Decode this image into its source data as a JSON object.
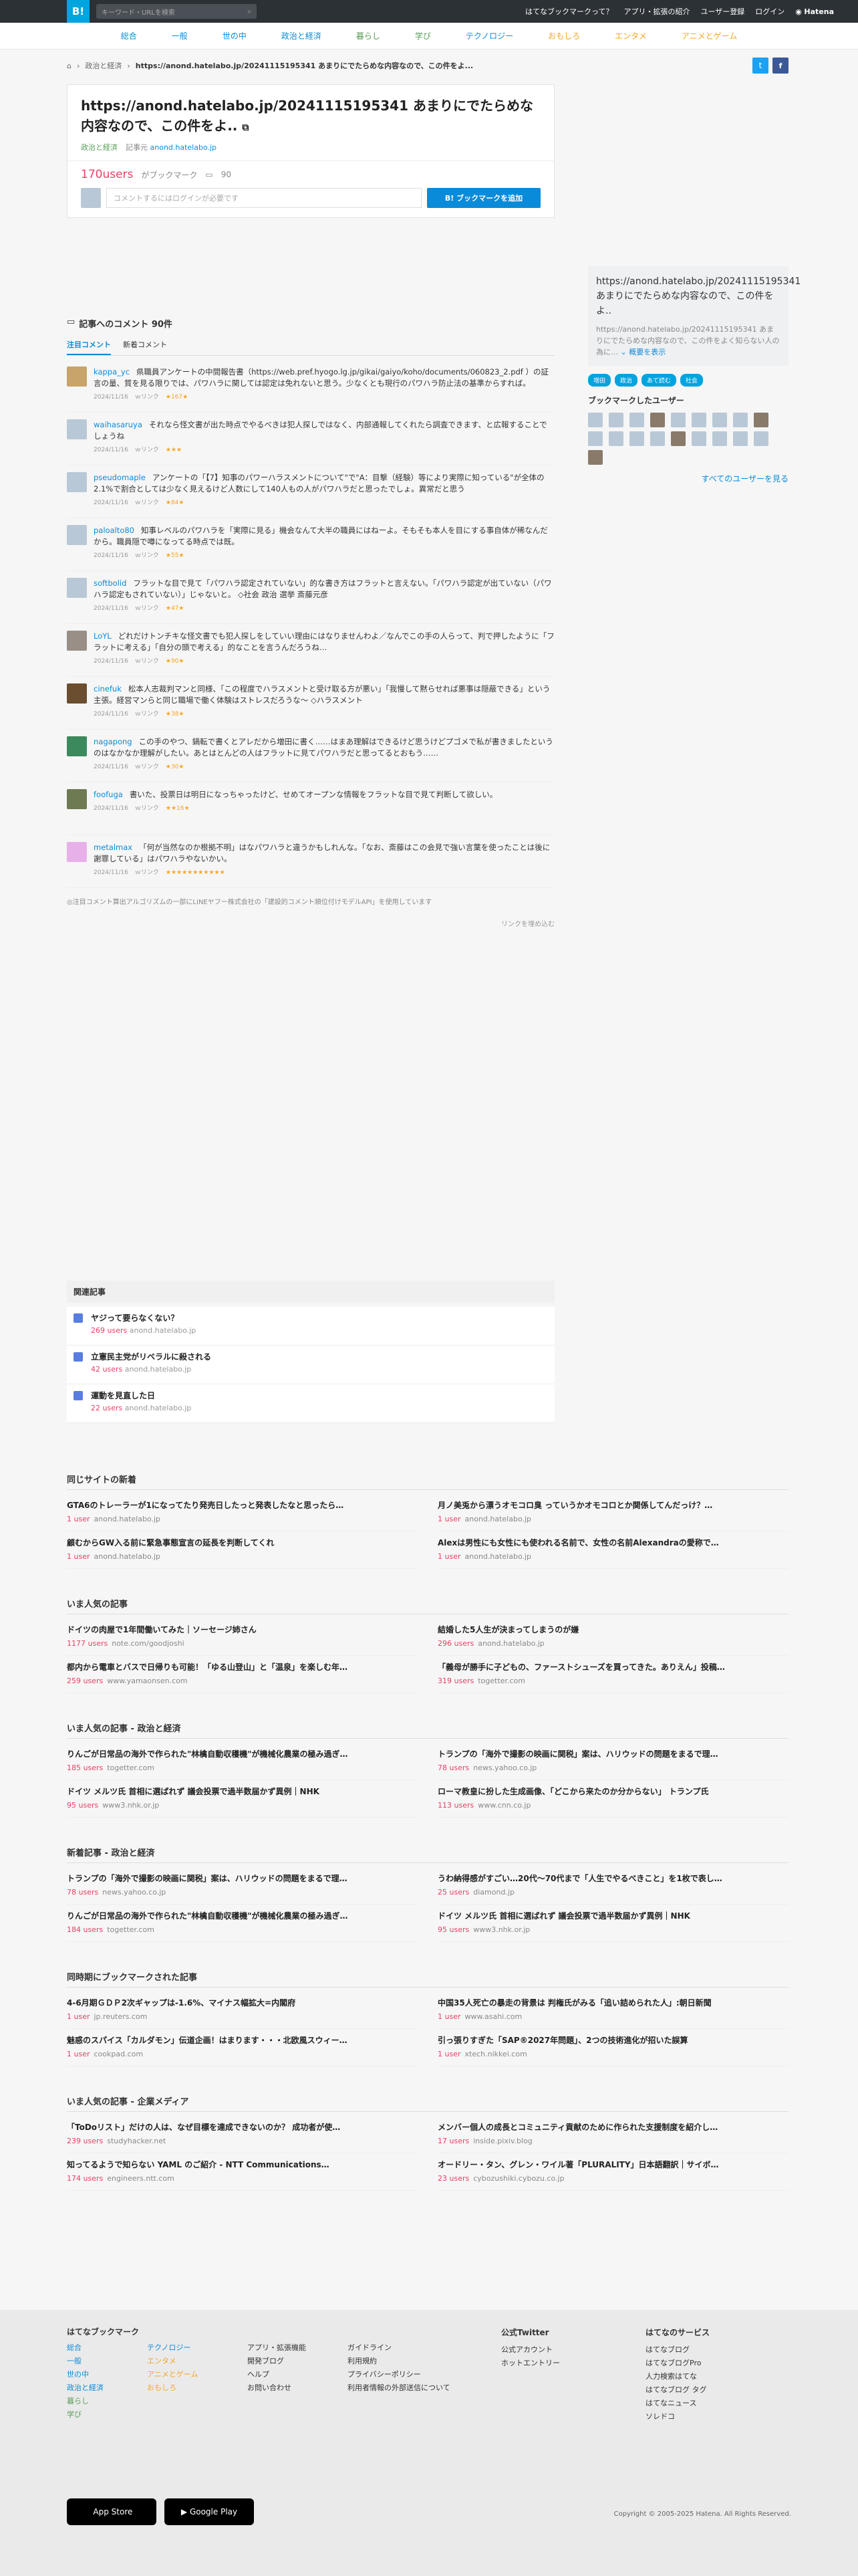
{
  "topbar": {
    "logo": "B!",
    "search_placeholder": "キーワード・URLを検索",
    "nav": [
      "はてなブックマークって？",
      "アプリ・拡張の紹介",
      "ユーザー登録",
      "ログイン"
    ],
    "brand": "Hatena"
  },
  "categories": [
    "総合",
    "一般",
    "世の中",
    "政治と経済",
    "暮らし",
    "学び",
    "テクノロジー",
    "おもしろ",
    "エンタメ",
    "アニメとゲーム"
  ],
  "breadcrumb": {
    "category": "政治と経済",
    "url": "https://anond.hatelabo.jp/20241115195341 あまりにでたらめな内容なので、この件をよ..."
  },
  "entry": {
    "title": "https://anond.hatelabo.jp/20241115195341 あまりにでたらめな内容なので、この件をよ..",
    "category": "政治と経済",
    "source_label": "記事元",
    "source": "anond.hatelabo.jp",
    "users": "170users",
    "bookmark_label": "がブックマーク",
    "comment_count": "90",
    "comment_placeholder": "コメントするにはログインが必要です",
    "add_button": "B! ブックマークを追加"
  },
  "comments_section": {
    "heading": "記事へのコメント 90件",
    "tabs": [
      "注目コメント",
      "新着コメント"
    ],
    "items": [
      {
        "user": "kappa_yc",
        "text": "県職員アンケートの中間報告書（https://web.pref.hyogo.lg.jp/gikai/gaiyo/koho/documents/060823_2.pdf ）の証言の量、質を見る限りでは、パワハラに関しては認定は免れないと思う。少なくとも現行のパワハラ防止法の基準からすれば。",
        "date": "2024/11/16",
        "stars": "★167★"
      },
      {
        "user": "waihasaruya",
        "text": "それなら怪文書が出た時点でやるべきは犯人探しではなく、内部通報してくれたら調査できます、と広報することでしょうね",
        "date": "2024/11/16",
        "stars": "★★★"
      },
      {
        "user": "pseudomaple",
        "text": "アンケートの「【7】知事のパワーハラスメントについて\"で\"A：目撃（経験）等により実際に知っている\"が全体の2.1%で割合としては少なく見えるけど人数にして140人もの人がパワハラだと思ったでしょ。異常だと思う",
        "date": "2024/11/16",
        "stars": "★84★"
      },
      {
        "user": "paloalto80",
        "text": "知事レベルのパワハラを「実際に見る」機会なんて大半の職員にはねーよ。そもそも本人を目にする事自体が稀なんだから。職員隠で噂になってる時点では既。",
        "date": "2024/11/16",
        "stars": "★55★"
      },
      {
        "user": "softbolid",
        "text": "フラットな目で見て「パワハラ認定されていない」的な書き方はフラットと言えない。「パワハラ認定が出ていない（パワハラ認定もされていない）」じゃないと。 ◇社会 政治 選挙 斎藤元彦",
        "date": "2024/11/16",
        "stars": "★47★"
      },
      {
        "user": "LoYL",
        "text": "どれだけトンチキな怪文書でも犯人探しをしていい理由にはなりませんわよ／なんでこの手の人らって、判で押したように「フラットに考える」「自分の頭で考える」的なことを言うんだろうね…",
        "date": "2024/11/16",
        "stars": "★90★"
      },
      {
        "user": "cinefuk",
        "text": "松本人志裁判マンと同様、「この程度でハラスメントと受け取る方が悪い」「我慢して黙らせれば悪事は隠蔽できる」という主張。経営マンらと同じ職場で働く体験はストレスだろうな〜 ◇ハラスメント",
        "date": "2024/11/16",
        "stars": "★38★"
      },
      {
        "user": "nagapong",
        "text": "この手のやつ、鍋転で書くとアレだから増田に書く……はまあ理解はできるけど思うけどプゴメで私が書きましたというのはなかなか理解がしたい。あとはとんどの人はフラットに見てパワハラだと思ってるとおもう……",
        "date": "2024/11/16",
        "stars": "★30★"
      },
      {
        "user": "foofuga",
        "text": "書いた、投票日は明日になっちゃったけど、せめてオープンな情報をフラットな目で見て判断して欲しい。",
        "date": "2024/11/16",
        "stars": "★★16★"
      },
      {
        "user": "metalmax",
        "text": "「何が当然なのか根拠不明」はなパワハラと違うかもしれんな。「なお、斎藤はこの会見で強い言葉を使ったことは後に謝罪している」はパワハラやないかい。",
        "date": "2024/11/16",
        "stars": "★★★★★★★★★★★"
      }
    ],
    "link_label": "ｗリンク",
    "note": "◎注目コメント算出アルゴリズムの一部にLINEヤフー株式会社の「建設的コメント順位付けモデルAPI」を使用しています",
    "embed": "リンクを埋め込む"
  },
  "sidebar": {
    "title": "https://anond.hatelabo.jp/20241115195341 あまりにでたらめな内容なので、この件をよ..",
    "desc": "https://anond.hatelabo.jp/20241115195341 あまりにでたらめな内容なので、この件をよく知らない人の為に…",
    "desc_more": "概要を表示",
    "tags": [
      "増田",
      "政治",
      "あて読む",
      "社会"
    ],
    "users_heading": "ブックマークしたユーザー",
    "all_users": "すべてのユーザーを見る"
  },
  "related": {
    "heading": "関連記事",
    "items": [
      {
        "title": "ヤジって要らなくない？",
        "users": "269 users",
        "domain": "anond.hatelabo.jp"
      },
      {
        "title": "立憲民主党がリベラルに殺される",
        "users": "42 users",
        "domain": "anond.hatelabo.jp"
      },
      {
        "title": "運動を見直した日",
        "users": "22 users",
        "domain": "anond.hatelabo.jp"
      }
    ]
  },
  "blocks": [
    {
      "heading": "同じサイトの新着",
      "items": [
        {
          "title": "GTA6のトレーラーが1になってたり発売日したっと発表したなと思ったら…",
          "users": "1 user",
          "domain": "anond.hatelabo.jp"
        },
        {
          "title": "月ノ美兎から漂うオモコロ臭 っていうかオモコロとか関係してんだっけ？…",
          "users": "1 user",
          "domain": "anond.hatelabo.jp"
        },
        {
          "title": "顧むからGW入る前に緊急事態宣言の延長を判断してくれ",
          "users": "1 user",
          "domain": "anond.hatelabo.jp"
        },
        {
          "title": "Alexは男性にも女性にも使われる名前で、女性の名前Alexandraの愛称で…",
          "users": "1 user",
          "domain": "anond.hatelabo.jp"
        }
      ]
    },
    {
      "heading": "いま人気の記事",
      "items": [
        {
          "title": "ドイツの肉屋で1年間働いてみた｜ソーセージ姉さん",
          "users": "1177 users",
          "domain": "note.com/goodjoshi"
        },
        {
          "title": "結婚した5人生が決まってしまうのが嫌",
          "users": "296 users",
          "domain": "anond.hatelabo.jp"
        },
        {
          "title": "都内から電車とバスで日帰りも可能！「ゆる山登山」と「温泉」を楽しむ年…",
          "users": "259 users",
          "domain": "www.yamaonsen.com"
        },
        {
          "title": "「義母が勝手に子どもの、ファーストシューズを買ってきた。ありえん」投稿…",
          "users": "319 users",
          "domain": "togetter.com"
        }
      ]
    },
    {
      "heading": "いま人気の記事 - 政治と経済",
      "items": [
        {
          "title": "りんごが日常品の海外で作られた\"林檎自動収穫機\"が機械化農業の極み過ぎ…",
          "users": "185 users",
          "domain": "togetter.com"
        },
        {
          "title": "トランプの「海外で撮影の映画に関税」案は、ハリウッドの問題をまるで理…",
          "users": "78 users",
          "domain": "news.yahoo.co.jp"
        },
        {
          "title": "ドイツ メルツ氏 首相に選ばれず 議会投票で過半数届かず異例｜NHK",
          "users": "95 users",
          "domain": "www3.nhk.or.jp"
        },
        {
          "title": "ローマ教皇に扮した生成画像、「どこから来たのか分からない」 トランプ氏",
          "users": "113 users",
          "domain": "www.cnn.co.jp"
        }
      ]
    },
    {
      "heading": "新着記事 - 政治と経済",
      "items": [
        {
          "title": "トランプの「海外で撮影の映画に関税」案は、ハリウッドの問題をまるで理…",
          "users": "78 users",
          "domain": "news.yahoo.co.jp"
        },
        {
          "title": "うわ納得感がすごい…20代〜70代まで「人生でやるべきこと」を1枚で表し…",
          "users": "25 users",
          "domain": "diamond.jp"
        },
        {
          "title": "りんごが日常品の海外で作られた\"林檎自動収穫機\"が機械化農業の極み過ぎ…",
          "users": "184 users",
          "domain": "togetter.com"
        },
        {
          "title": "ドイツ メルツ氏 首相に選ばれず 議会投票で過半数届かず異例｜NHK",
          "users": "95 users",
          "domain": "www3.nhk.or.jp"
        }
      ]
    },
    {
      "heading": "同時期にブックマークされた記事",
      "items": [
        {
          "title": "4-6月期ＧＤＰ2次ギャップは-1.6%、マイナス幅拡大=内閣府",
          "users": "1 user",
          "domain": "jp.reuters.com"
        },
        {
          "title": "中国35人死亡の暴走の背景は 判権氏がみる「追い詰められた人」:朝日新聞",
          "users": "1 user",
          "domain": "www.asahi.com"
        },
        {
          "title": "魅惑のスパイス「カルダモン」伝道企画！はまります・・・北欧風スウィー…",
          "users": "1 user",
          "domain": "cookpad.com"
        },
        {
          "title": "引っ張りすぎた「SAP®2027年問題」、2つの技術進化が招いた誤算",
          "users": "1 user",
          "domain": "xtech.nikkei.com"
        }
      ]
    },
    {
      "heading": "いま人気の記事 - 企業メディア",
      "items": [
        {
          "title": "「ToDoリスト」だけの人は、なぜ目標を達成できないのか？ 成功者が使…",
          "users": "239 users",
          "domain": "studyhacker.net"
        },
        {
          "title": "メンバー個人の成長とコミュニティ貢献のために作られた支援制度を紹介し…",
          "users": "17 users",
          "domain": "inside.pixiv.blog"
        },
        {
          "title": "知ってるようで知らない YAML のご紹介 - NTT Communications…",
          "users": "174 users",
          "domain": "engineers.ntt.com"
        },
        {
          "title": "オードリー・タン、グレン・ワイル著「PLURALITY」日本語翻訳｜サイボ…",
          "users": "23 users",
          "domain": "cybozushiki.cybozu.co.jp"
        }
      ]
    }
  ],
  "footer": {
    "bookmark_heading": "はてなブックマーク",
    "col1": [
      "総合",
      "一般",
      "世の中",
      "政治と経済",
      "暮らし",
      "学び"
    ],
    "col2": [
      "テクノロジー",
      "エンタメ",
      "アニメとゲーム",
      "おもしろ"
    ],
    "col3": [
      "アプリ・拡張機能",
      "開発ブログ",
      "ヘルプ",
      "お問い合わせ"
    ],
    "col4": [
      "ガイドライン",
      "利用規約",
      "プライバシーポリシー",
      "利用者情報の外部送信について"
    ],
    "twitter_heading": "公式Twitter",
    "twitter": [
      "公式アカウント",
      "ホットエントリー"
    ],
    "services_heading": "はてなのサービス",
    "services": [
      "はてなブログ",
      "はてなブログPro",
      "人力検索はてな",
      "はてなブログ タグ",
      "はてなニュース",
      "ソレドコ"
    ],
    "appstore": "App Store",
    "googleplay": "Google Play",
    "copyright": "Copyright © 2005-2025 Hatena. All Rights Reserved."
  },
  "colors": {
    "accent": "#00a4de",
    "users": "#e94065",
    "link": "#0a8bd9"
  }
}
